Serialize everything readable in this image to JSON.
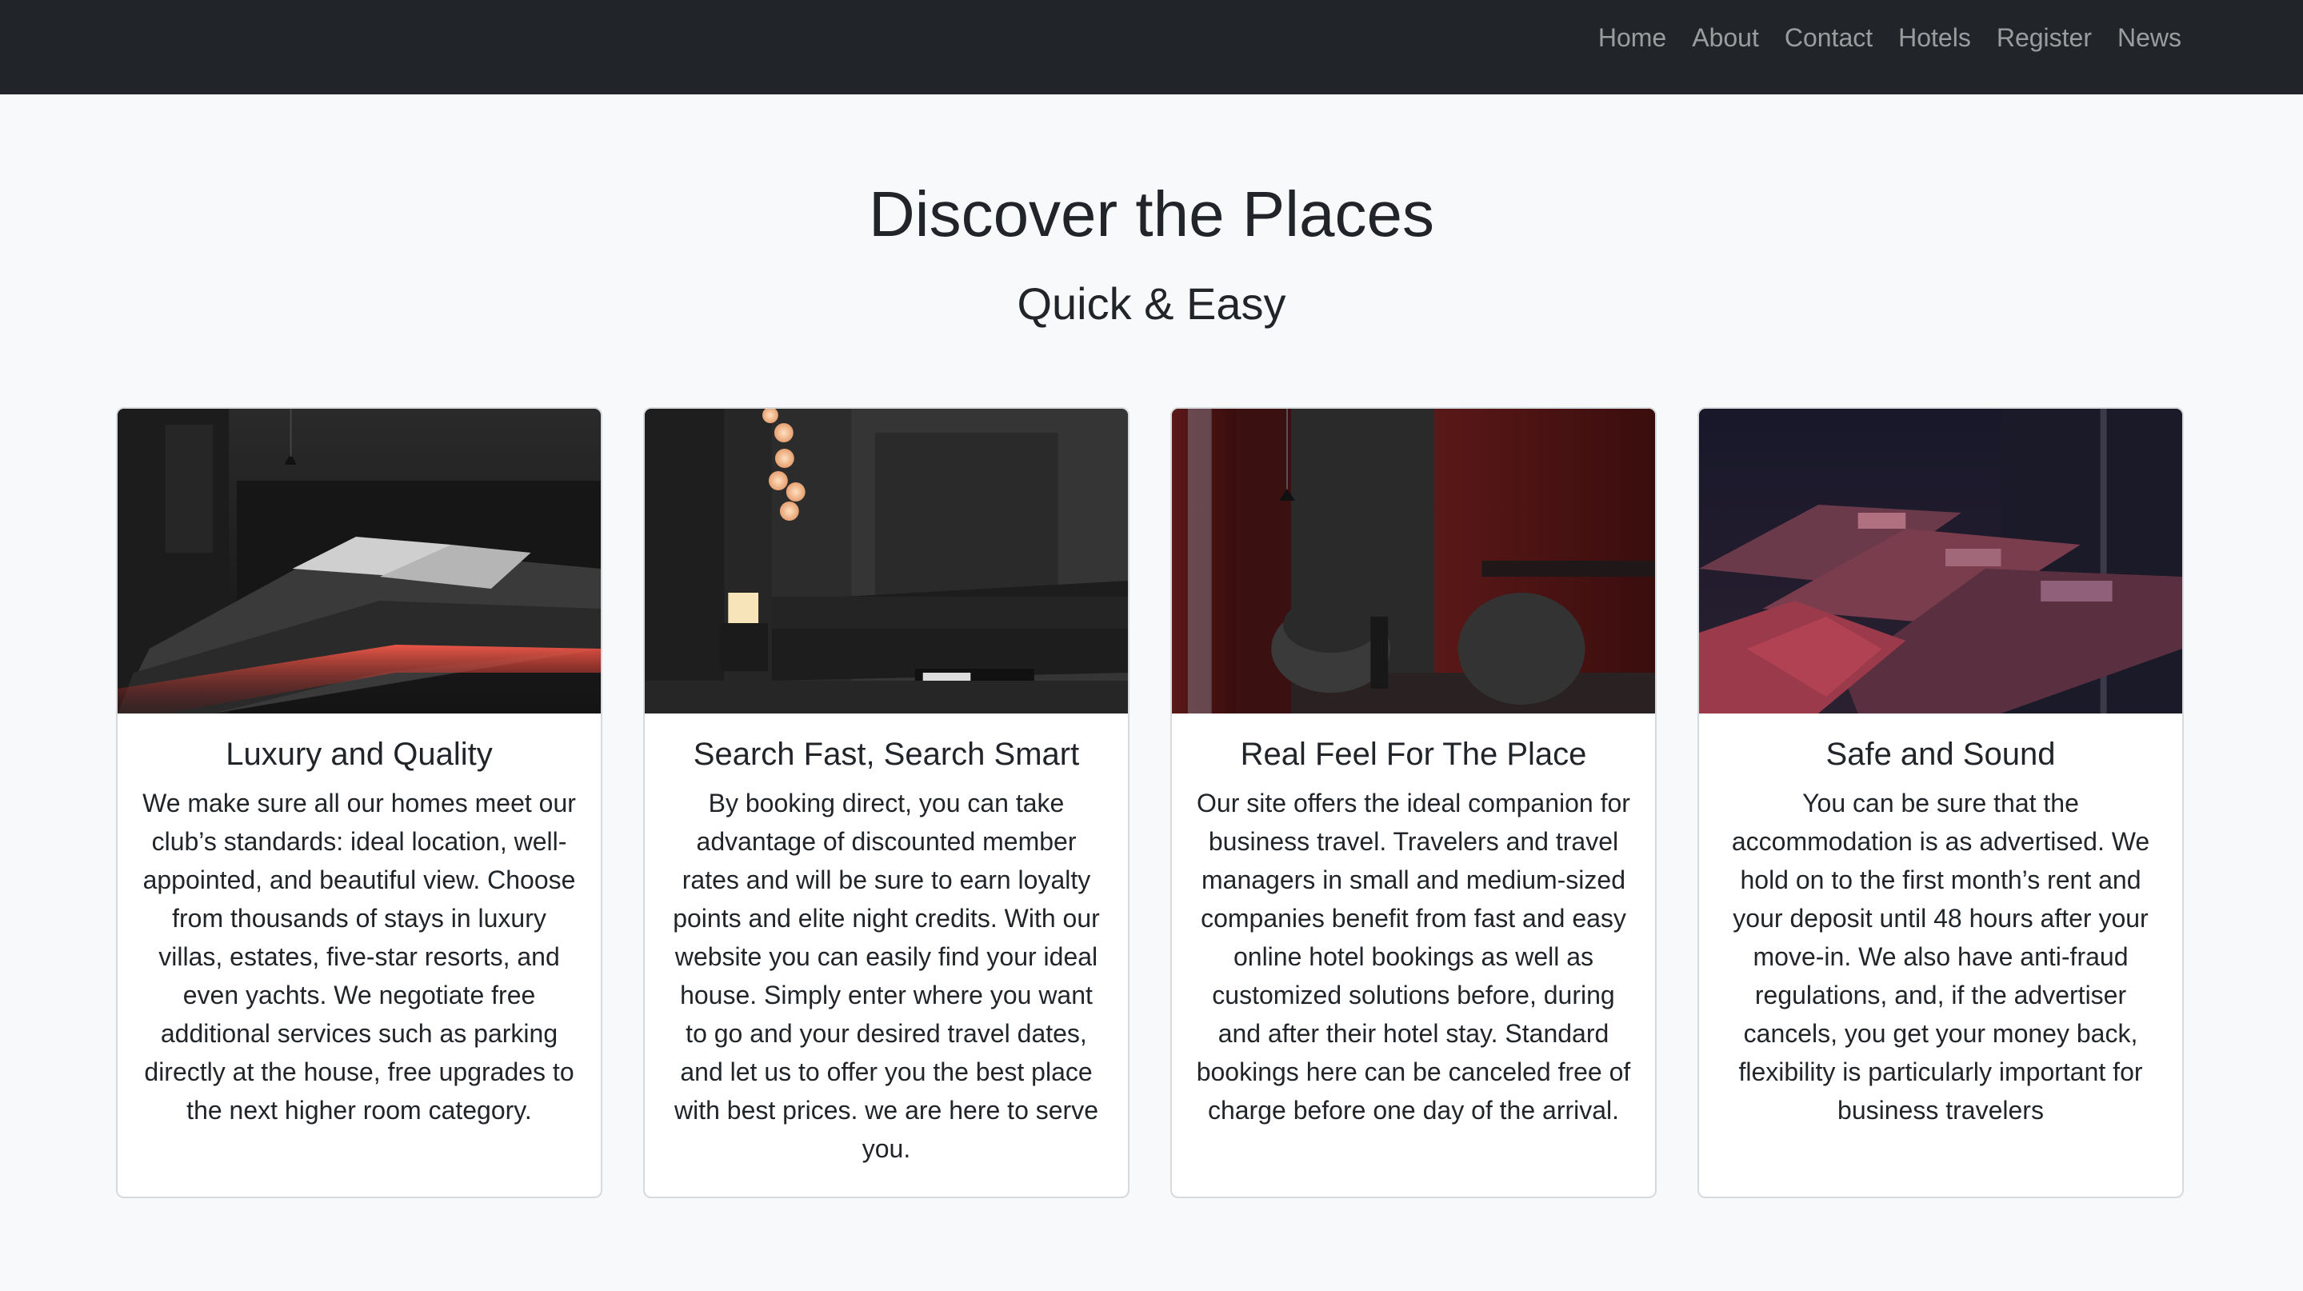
{
  "nav": {
    "items": [
      "Home",
      "About",
      "Contact",
      "Hotels",
      "Register",
      "News"
    ]
  },
  "hero": {
    "title": "Discover the Places",
    "subtitle": "Quick & Easy"
  },
  "cards": [
    {
      "title": "Luxury and Quality",
      "text": "We make sure all our homes meet our club’s standards: ideal location, well-appointed, and beautiful view. Choose from thousands of stays in luxury villas, estates, five-star resorts, and even yachts. We negotiate free additional services such as parking directly at the house, free upgrades to the next higher room category."
    },
    {
      "title": "Search Fast, Search Smart",
      "text": "By booking direct, you can take advantage of discounted member rates and will be sure to earn loyalty points and elite night credits. With our website you can easily find your ideal house. Simply enter where you want to go and your desired travel dates, and let us to offer you the best place with best prices. we are here to serve you."
    },
    {
      "title": "Real Feel For The Place",
      "text": "Our site offers the ideal companion for business travel. Travelers and travel managers in small and medium-sized companies benefit from fast and easy online hotel bookings as well as customized solutions before, during and after their hotel stay. Standard bookings here can be canceled free of charge before one day of the arrival."
    },
    {
      "title": "Safe and Sound",
      "text": "You can be sure that the accommodation is as advertised. We hold on to the first month’s rent and your deposit until 48 hours after your move-in. We also have anti-fraud regulations, and, if the advertiser cancels, you get your money back, flexibility is particularly important for business travelers"
    }
  ]
}
